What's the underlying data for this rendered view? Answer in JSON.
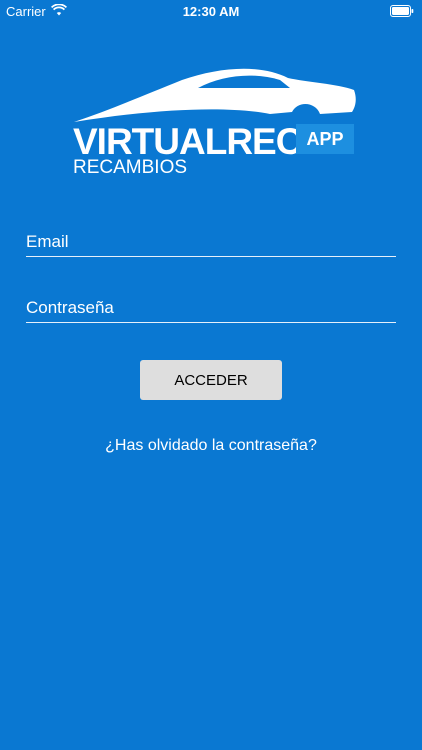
{
  "status_bar": {
    "carrier": "Carrier",
    "time": "12:30 AM",
    "wifi_icon": "wifi-icon",
    "battery_icon": "battery-icon"
  },
  "logo": {
    "brand": "VIRTUALREC",
    "badge": "APP",
    "subtitle": "RECAMBIOS",
    "icon": "car-icon"
  },
  "form": {
    "email_placeholder": "Email",
    "password_placeholder": "Contraseña",
    "submit_label": "ACCEDER",
    "forgot_label": "¿Has olvidado la contraseña?"
  },
  "colors": {
    "background": "#0a78d2",
    "badge": "#1d8fe0",
    "button": "#dedede"
  }
}
